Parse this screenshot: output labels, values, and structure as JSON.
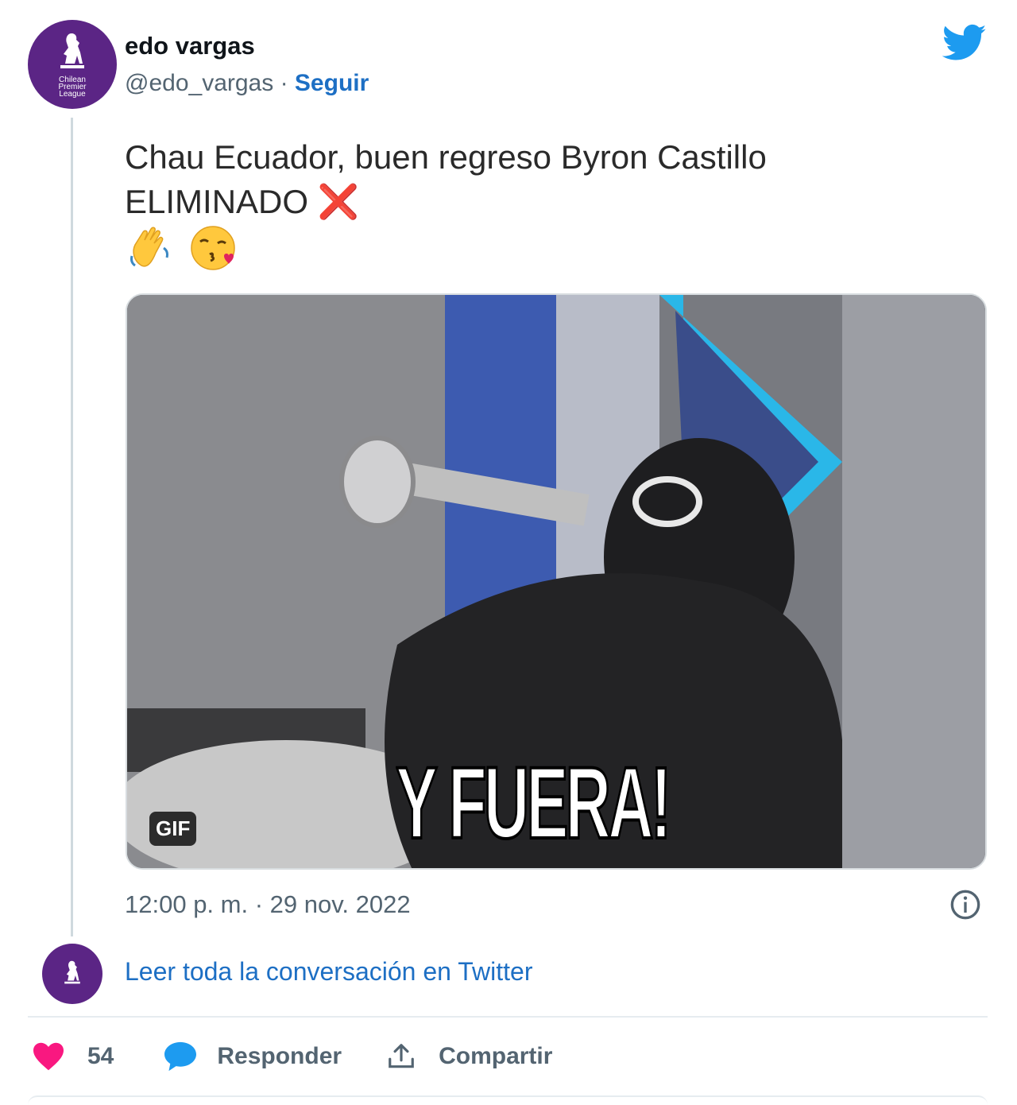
{
  "tweet": {
    "author_name": "edo vargas",
    "handle": "@edo_vargas",
    "separator": " · ",
    "follow_label": "Seguir",
    "avatar_text": "Chilean Premier League",
    "text_line1": "Chau Ecuador, buen regreso Byron Castillo",
    "text_line2": "ELIMINADO",
    "emoji_cross": "❌",
    "emoji_wave": "👋",
    "emoji_kiss": "😘",
    "media_caption": "Y FUERA!",
    "gif_label": "GIF",
    "timestamp": "12:00 p. m. · 29 nov. 2022",
    "read_conversation": "Leer toda la conversación en Twitter"
  },
  "actions": {
    "likes_count": "54",
    "reply_label": "Responder",
    "share_label": "Compartir"
  },
  "icons": {
    "brand": "twitter-bird-icon",
    "info": "info-icon",
    "like": "heart-icon",
    "reply": "speech-bubble-icon",
    "share": "share-upload-icon"
  },
  "colors": {
    "twitter_blue": "#1d9bf0",
    "link_blue": "#1d6fc4",
    "heart": "#f91880",
    "avatar_purple": "#5b2585",
    "muted_text": "#536471"
  }
}
